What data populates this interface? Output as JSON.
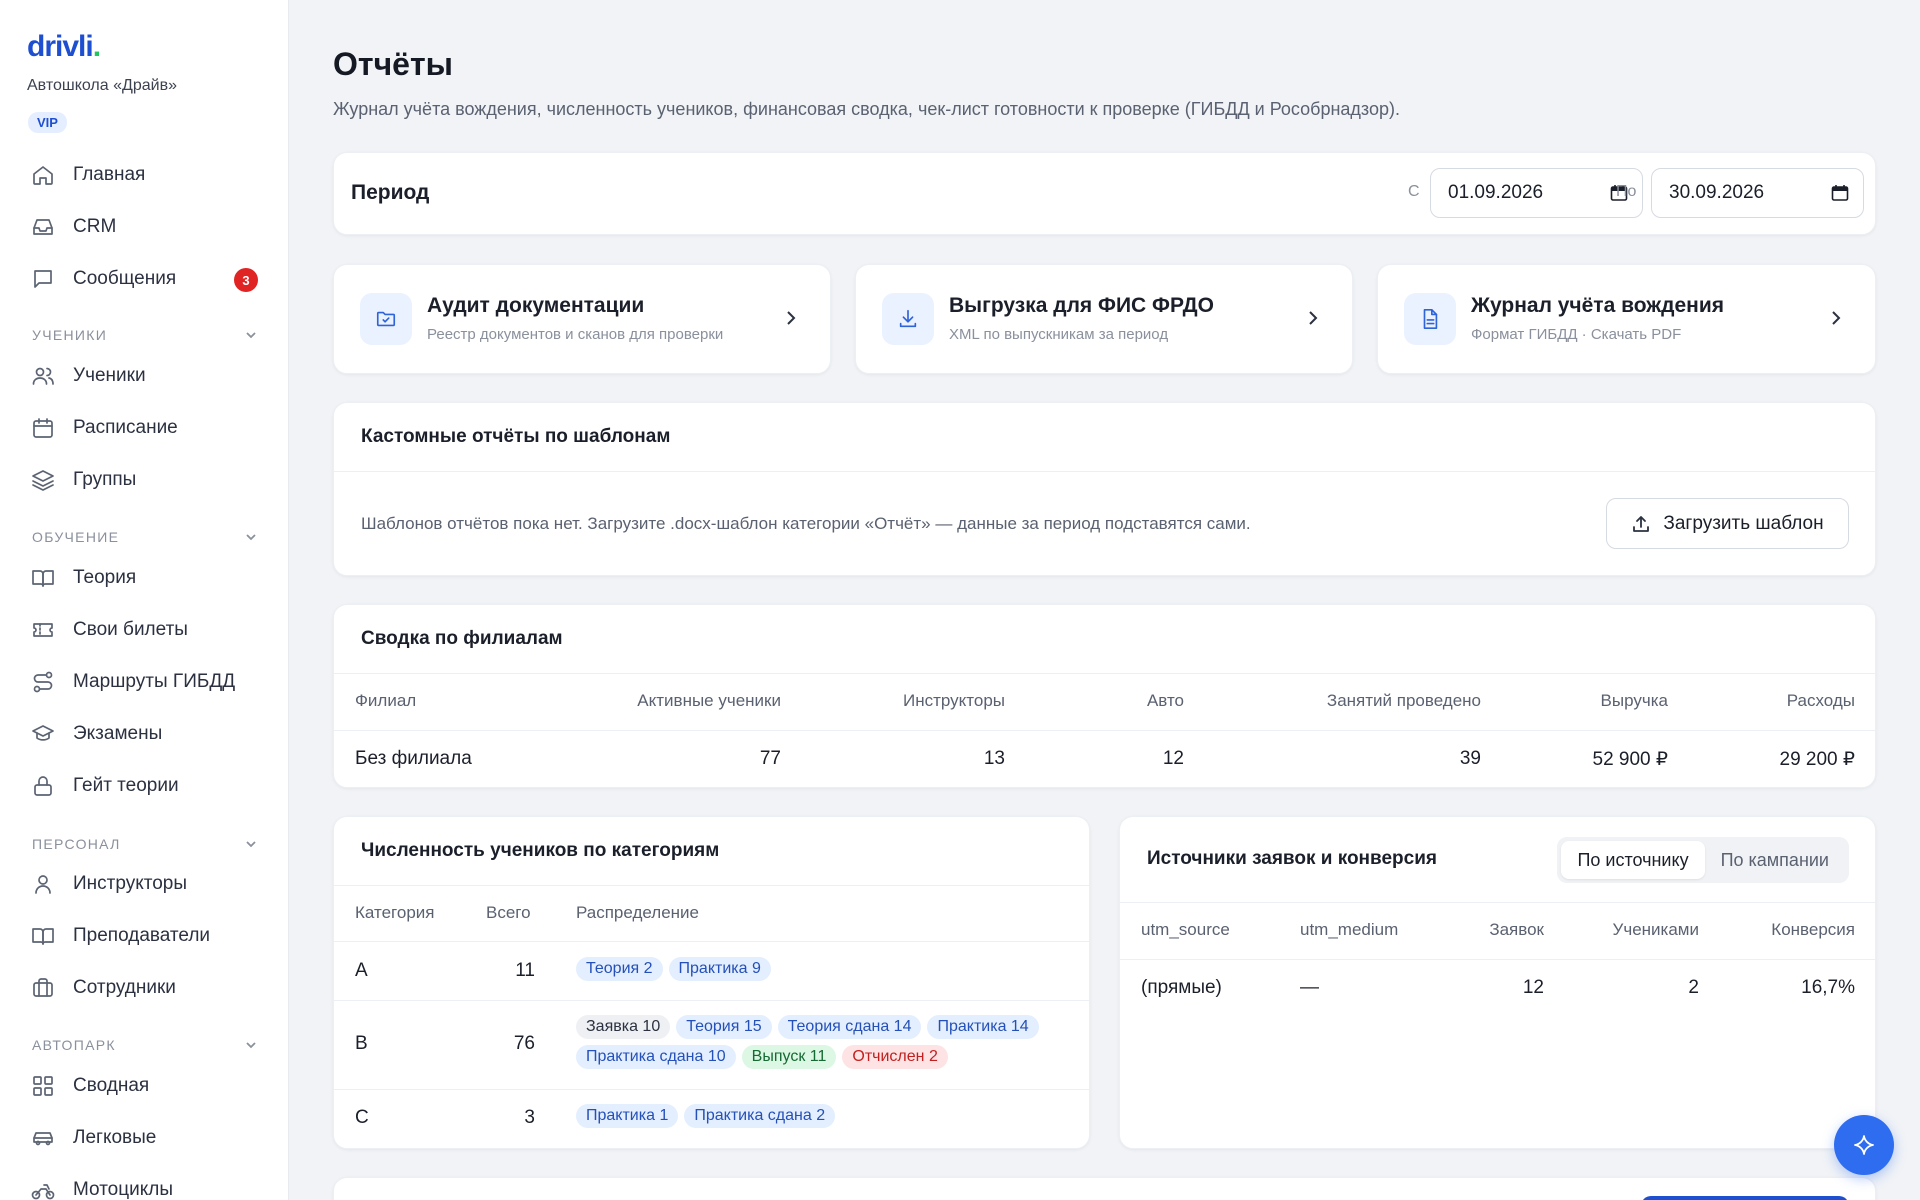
{
  "sidebar": {
    "logo": "drivli",
    "logo_dot": ".",
    "school": "Автошкола «Драйв»",
    "badge": "VIP",
    "items_top": [
      {
        "label": "Главная",
        "icon": "home-icon"
      },
      {
        "label": "CRM",
        "icon": "inbox-icon"
      },
      {
        "label": "Сообщения",
        "icon": "message-icon",
        "badge": "3"
      }
    ],
    "sections": [
      {
        "title": "УЧЕНИКИ",
        "items": [
          "Ученики",
          "Расписание",
          "Группы"
        ]
      },
      {
        "title": "ОБУЧЕНИЕ",
        "items": [
          "Теория",
          "Свои билеты",
          "Маршруты ГИБДД",
          "Экзамены",
          "Гейт теории"
        ]
      },
      {
        "title": "ПЕРСОНАЛ",
        "items": [
          "Инструкторы",
          "Преподаватели",
          "Сотрудники"
        ]
      },
      {
        "title": "АВТОПАРК",
        "items": [
          "Сводная",
          "Легковые",
          "Мотоциклы"
        ]
      }
    ]
  },
  "header": {
    "title": "Отчёты",
    "subtitle": "Журнал учёта вождения, численность учеников, финансовая сводка, чек-лист готовности к проверке (ГИБДД и Рособрнадзор)."
  },
  "period": {
    "label": "Период",
    "from_label": "С",
    "from_value": "01.09.2026",
    "to_label": "По",
    "to_value": "30.09.2026"
  },
  "quick_cards": [
    {
      "title": "Аудит документации",
      "subtitle": "Реестр документов и сканов для проверки",
      "icon": "folder-check-icon"
    },
    {
      "title": "Выгрузка для ФИС ФРДО",
      "subtitle": "XML по выпускникам за период",
      "icon": "download-icon"
    },
    {
      "title": "Журнал учёта вождения",
      "subtitle": "Формат ГИБДД · Скачать PDF",
      "icon": "document-icon"
    }
  ],
  "templates": {
    "title": "Кастомные отчёты по шаблонам",
    "empty_text": "Шаблонов отчётов пока нет. Загрузите .docx-шаблон категории «Отчёт» — данные за период подставятся сами.",
    "upload_label": "Загрузить шаблон"
  },
  "branches": {
    "title": "Сводка по филиалам",
    "headers": [
      "Филиал",
      "Активные ученики",
      "Инструкторы",
      "Авто",
      "Занятий проведено",
      "Выручка",
      "Расходы"
    ],
    "rows": [
      [
        "Без филиала",
        "77",
        "13",
        "12",
        "39",
        "52 900 ₽",
        "29 200 ₽"
      ]
    ]
  },
  "categories": {
    "title": "Численность учеников по категориям",
    "headers": [
      "Категория",
      "Всего",
      "Распределение"
    ],
    "rows": [
      {
        "cat": "A",
        "total": "11",
        "chips": [
          {
            "text": "Теория 2",
            "color": "blue"
          },
          {
            "text": "Практика 9",
            "color": "blue"
          }
        ]
      },
      {
        "cat": "B",
        "total": "76",
        "chips": [
          {
            "text": "Заявка 10",
            "color": "gray"
          },
          {
            "text": "Теория 15",
            "color": "blue"
          },
          {
            "text": "Теория сдана 14",
            "color": "blue"
          },
          {
            "text": "Практика 14",
            "color": "blue"
          },
          {
            "text": "Практика сдана 10",
            "color": "blue"
          },
          {
            "text": "Выпуск 11",
            "color": "green"
          },
          {
            "text": "Отчислен 2",
            "color": "red"
          }
        ]
      },
      {
        "cat": "C",
        "total": "3",
        "chips": [
          {
            "text": "Практика 1",
            "color": "blue"
          },
          {
            "text": "Практика сдана 2",
            "color": "blue"
          }
        ]
      }
    ]
  },
  "sources": {
    "title": "Источники заявок и конверсия",
    "tab_active": "По источнику",
    "tab_inactive": "По кампании",
    "headers": [
      "utm_source",
      "utm_medium",
      "Заявок",
      "Учениками",
      "Конверсия"
    ],
    "rows": [
      [
        "(прямые)",
        "—",
        "12",
        "2",
        "16,7%"
      ]
    ]
  },
  "colors": {
    "accent": "#2f6df0",
    "brand": "#1f4fd1",
    "badge_red": "#e02424"
  },
  "fab": {
    "icon": "sparkle-icon"
  }
}
